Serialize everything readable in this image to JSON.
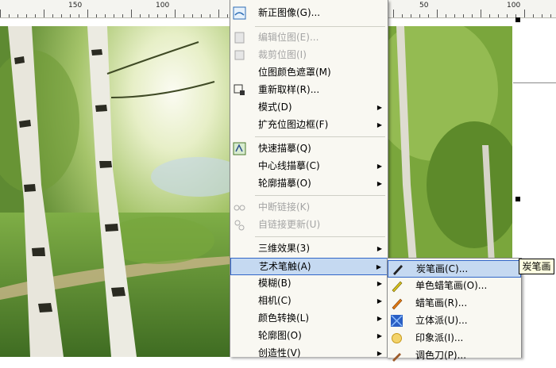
{
  "ruler": {
    "labels": [
      "150",
      "100",
      "50",
      "100"
    ]
  },
  "main_menu": {
    "items": [
      {
        "label": "新正图像(G)...",
        "disabled": false,
        "has_submenu": false,
        "icon": "straighten-image-icon"
      },
      {
        "label": "编辑位图(E)...",
        "disabled": true,
        "has_submenu": false,
        "icon": "edit-bitmap-icon"
      },
      {
        "label": "裁剪位图(I)",
        "disabled": true,
        "has_submenu": false,
        "icon": "crop-bitmap-icon"
      },
      {
        "label": "位图颜色遮罩(M)",
        "disabled": false,
        "has_submenu": false,
        "icon": ""
      },
      {
        "label": "重新取样(R)...",
        "disabled": false,
        "has_submenu": false,
        "icon": "resample-icon"
      },
      {
        "label": "模式(D)",
        "disabled": false,
        "has_submenu": true,
        "icon": ""
      },
      {
        "label": "扩充位图边框(F)",
        "disabled": false,
        "has_submenu": true,
        "icon": ""
      },
      {
        "label": "快速描摹(Q)",
        "disabled": false,
        "has_submenu": false,
        "icon": "quick-trace-icon"
      },
      {
        "label": "中心线描摹(C)",
        "disabled": false,
        "has_submenu": true,
        "icon": ""
      },
      {
        "label": "轮廓描摹(O)",
        "disabled": false,
        "has_submenu": true,
        "icon": ""
      },
      {
        "label": "中断链接(K)",
        "disabled": true,
        "has_submenu": false,
        "icon": "break-link-icon"
      },
      {
        "label": "自链接更新(U)",
        "disabled": true,
        "has_submenu": false,
        "icon": "update-link-icon"
      },
      {
        "label": "三维效果(3)",
        "disabled": false,
        "has_submenu": true,
        "icon": ""
      },
      {
        "label": "艺术笔触(A)",
        "disabled": false,
        "has_submenu": true,
        "icon": "",
        "highlighted": true
      },
      {
        "label": "模糊(B)",
        "disabled": false,
        "has_submenu": true,
        "icon": ""
      },
      {
        "label": "相机(C)",
        "disabled": false,
        "has_submenu": true,
        "icon": ""
      },
      {
        "label": "颜色转换(L)",
        "disabled": false,
        "has_submenu": true,
        "icon": ""
      },
      {
        "label": "轮廓图(O)",
        "disabled": false,
        "has_submenu": true,
        "icon": ""
      },
      {
        "label": "创造性(V)",
        "disabled": false,
        "has_submenu": true,
        "icon": ""
      }
    ]
  },
  "sub_menu": {
    "items": [
      {
        "label": "炭笔画(C)...",
        "icon": "charcoal-icon",
        "highlighted": true
      },
      {
        "label": "单色蜡笔画(O)...",
        "icon": "conte-crayon-icon"
      },
      {
        "label": "蜡笔画(R)...",
        "icon": "crayon-icon"
      },
      {
        "label": "立体派(U)...",
        "icon": "cubist-icon"
      },
      {
        "label": "印象派(I)...",
        "icon": "impressionist-icon"
      },
      {
        "label": "调色刀(P)...",
        "icon": "palette-knife-icon"
      }
    ]
  },
  "tooltip": {
    "text": "炭笔画"
  },
  "colors": {
    "menu_bg": "#f9f8f2",
    "highlight_bg": "#c5d9f1",
    "highlight_border": "#3166c8",
    "disabled_text": "#a4a4a4"
  }
}
